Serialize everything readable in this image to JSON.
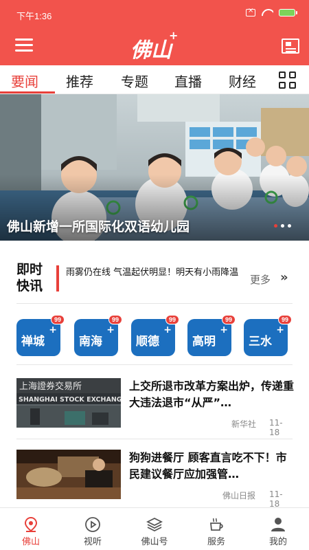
{
  "status_bar": {
    "time": "下午1:36"
  },
  "header": {
    "logo_text": "佛山",
    "logo_plus": "+",
    "menu_icon": "hamburger-icon",
    "right_icon": "newspaper-icon",
    "accent_color": "#f2534c"
  },
  "tabs": [
    {
      "label": "要闻",
      "active": true
    },
    {
      "label": "推荐",
      "active": false
    },
    {
      "label": "专题",
      "active": false
    },
    {
      "label": "直播",
      "active": false
    },
    {
      "label": "财经",
      "active": false
    }
  ],
  "hero": {
    "caption": "佛山新增一所国际化双语幼儿园",
    "slide_count": 3,
    "active_slide": 1
  },
  "quick_news": {
    "title": "即时快讯",
    "title_line1": "即时",
    "title_line2": "快讯",
    "text": "雨雾仍在线 气温起伏明显！明天有小雨降温",
    "more_label": "更多",
    "more_icon": "double-chevron-right-icon"
  },
  "districts": [
    {
      "label": "禅城",
      "plus": "+",
      "badge": "99"
    },
    {
      "label": "南海",
      "plus": "+",
      "badge": "99"
    },
    {
      "label": "顺德",
      "plus": "+",
      "badge": "99"
    },
    {
      "label": "高明",
      "plus": "+",
      "badge": "99"
    },
    {
      "label": "三水",
      "plus": "+",
      "badge": "99"
    }
  ],
  "news": [
    {
      "title": "上交所退市改革方案出炉，传递重大违法退市“从严”…",
      "source": "新华社",
      "date": "11-18",
      "thumb_text": "上海證券交易所",
      "thumb_text_en": "SHANGHAI STOCK EXCHANGE"
    },
    {
      "title": "狗狗进餐厅 顾客直言吃不下！市民建议餐厅应加强管…",
      "source": "佛山日报",
      "date": "11-18"
    }
  ],
  "bottom_nav": [
    {
      "label": "佛山",
      "icon": "location-pin-icon",
      "active": true
    },
    {
      "label": "视听",
      "icon": "play-circle-icon",
      "active": false
    },
    {
      "label": "佛山号",
      "icon": "layers-icon",
      "active": false
    },
    {
      "label": "服务",
      "icon": "coffee-cup-icon",
      "active": false
    },
    {
      "label": "我的",
      "icon": "user-icon",
      "active": false
    }
  ]
}
